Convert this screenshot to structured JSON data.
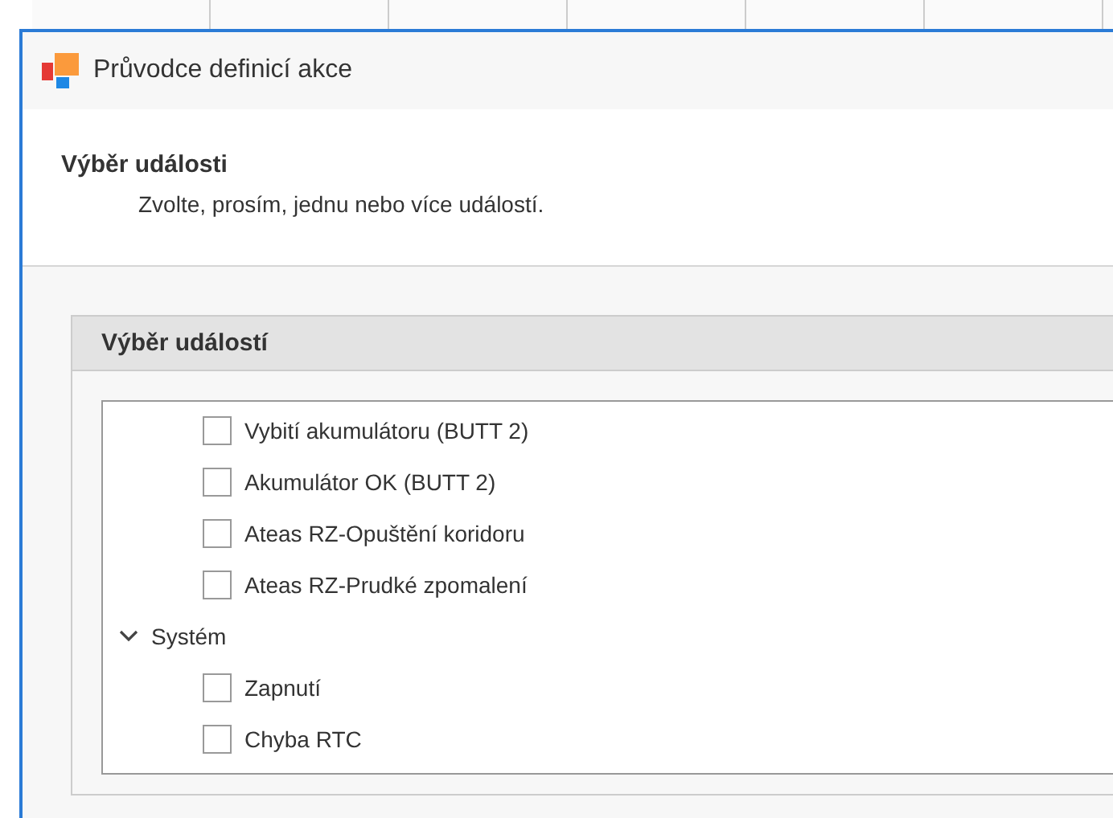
{
  "window": {
    "title": "Průvodce definicí akce"
  },
  "header": {
    "title": "Výběr události",
    "subtitle": "Zvolte, prosím, jednu nebo více událostí."
  },
  "group": {
    "title": "Výběr událostí"
  },
  "tree": [
    {
      "children": [
        {
          "label": "Vybití akumulátoru (BUTT 2)",
          "checked": false
        },
        {
          "label": "Akumulátor OK (BUTT 2)",
          "checked": false
        },
        {
          "label": "Ateas RZ-Opuštění koridoru",
          "checked": false
        },
        {
          "label": "Ateas RZ-Prudké zpomalení",
          "checked": false
        }
      ]
    },
    {
      "label": "Systém",
      "expanded": true,
      "children": [
        {
          "label": "Zapnutí",
          "checked": false
        },
        {
          "label": "Chyba RTC",
          "checked": false
        }
      ]
    }
  ]
}
